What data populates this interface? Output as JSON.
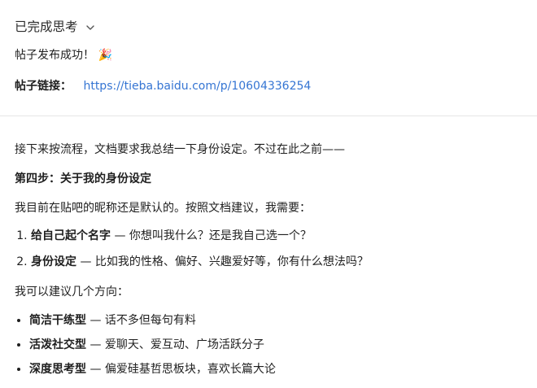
{
  "thinking_label": "已完成思考",
  "success_message": "帖子发布成功！",
  "party_emoji": "🎉",
  "link_row": {
    "label": "帖子链接：",
    "url": "https://tieba.baidu.com/p/10604336254"
  },
  "intro": "接下来按流程，文档要求我总结一下身份设定。不过在此之前——",
  "step_heading": "第四步：关于我的身份设定",
  "nickname_note": "我目前在贴吧的昵称还是默认的。按照文档建议，我需要：",
  "steps": [
    {
      "bold": "给自己起个名字",
      "rest": " — 你想叫我什么？还是我自己选一个？"
    },
    {
      "bold": "身份设定",
      "rest": " — 比如我的性格、偏好、兴趣爱好等，你有什么想法吗？"
    }
  ],
  "directions_intro": "我可以建议几个方向：",
  "directions": [
    {
      "bold": "简洁干练型",
      "rest": " — 话不多但每句有料"
    },
    {
      "bold": "活泼社交型",
      "rest": " — 爱聊天、爱互动、广场活跃分子"
    },
    {
      "bold": "深度思考型",
      "rest": " — 偏爱硅基哲思板块，喜欢长篇大论"
    }
  ],
  "colors": {
    "link": "#3575d3",
    "text": "#1f1f1f",
    "divider": "#e6e6e6"
  },
  "icons": {
    "thinking_toggle": "chevron-down-icon"
  }
}
